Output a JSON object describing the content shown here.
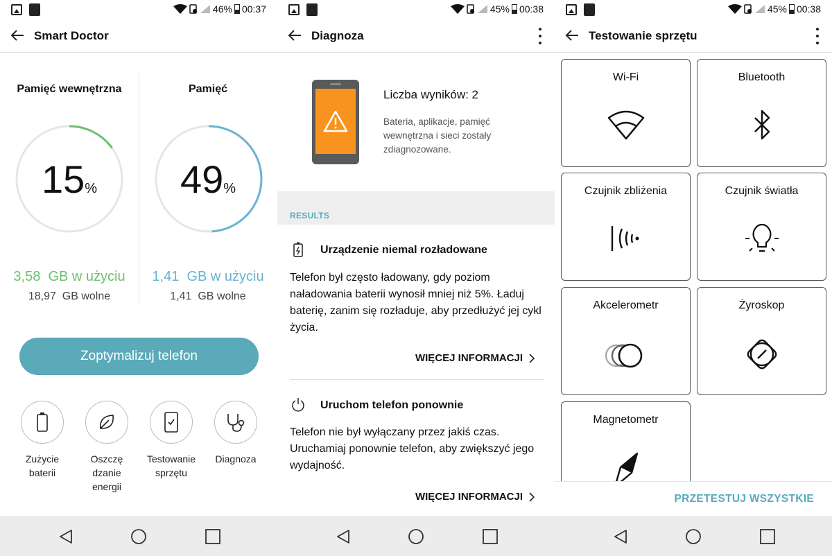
{
  "colors": {
    "accent": "#5aaab9",
    "green": "#6dbf6f",
    "blue": "#6ab4cf",
    "track": "#e6e6e6"
  },
  "panels": [
    {
      "status": {
        "battery": "46%",
        "time": "00:37"
      },
      "title": "Smart Doctor",
      "gauges": [
        {
          "label": "Pamięć wewnętrzna",
          "percent": 15,
          "value": "15",
          "unit": "%",
          "used_num": "3,58",
          "used_text": "GB w użyciu",
          "free_num": "18,97",
          "free_text": "GB wolne",
          "color": "#6dbf6f"
        },
        {
          "label": "Pamięć",
          "percent": 49,
          "value": "49",
          "unit": "%",
          "used_num": "1,41",
          "used_text": "GB w użyciu",
          "free_num": "1,41",
          "free_text": "GB wolne",
          "color": "#6ab4cf"
        }
      ],
      "optimize_label": "Zoptymalizuj telefon",
      "tools": [
        {
          "label_line1": "Zużycie",
          "label_line2": "baterii",
          "label_line3": "",
          "icon": "battery-icon"
        },
        {
          "label_line1": "Oszczę",
          "label_line2": "dzanie",
          "label_line3": "energii",
          "icon": "leaf-icon"
        },
        {
          "label_line1": "Testowanie",
          "label_line2": "sprzętu",
          "label_line3": "",
          "icon": "phone-check-icon"
        },
        {
          "label_line1": "Diagnoza",
          "label_line2": "",
          "label_line3": "",
          "icon": "stethoscope-icon"
        }
      ]
    },
    {
      "status": {
        "battery": "45%",
        "time": "00:38"
      },
      "title": "Diagnoza",
      "results_count": "Liczba wyników: 2",
      "results_desc": "Bateria, aplikacje, pamięć wewnętrzna i sieci zostały zdiagnozowane.",
      "results_header": "RESULTS",
      "issues": [
        {
          "title": "Urządzenie niemal rozładowane",
          "text": "Telefon był często ładowany, gdy poziom naładowania baterii wynosił mniej niż 5%. Ładuj baterię, zanim się rozładuje, aby przedłużyć jej cykl życia.",
          "more": "WIĘCEJ INFORMACJI",
          "icon": "battery-low-icon"
        },
        {
          "title": "Uruchom telefon ponownie",
          "text": "Telefon nie był wyłączany przez jakiś czas. Uruchamiaj ponownie telefon, aby zwiększyć jego wydajność.",
          "more": "WIĘCEJ INFORMACJI",
          "icon": "power-icon"
        }
      ]
    },
    {
      "status": {
        "battery": "45%",
        "time": "00:38"
      },
      "title": "Testowanie sprzętu",
      "tiles": [
        {
          "label": "Wi-Fi",
          "icon": "wifi-icon"
        },
        {
          "label": "Bluetooth",
          "icon": "bluetooth-icon"
        },
        {
          "label": "Czujnik zbliżenia",
          "icon": "proximity-icon"
        },
        {
          "label": "Czujnik światła",
          "icon": "light-bulb-icon"
        },
        {
          "label": "Akcelerometr",
          "icon": "accelerometer-icon"
        },
        {
          "label": "Żyroskop",
          "icon": "gyroscope-icon"
        },
        {
          "label": "Magnetometr",
          "icon": "compass-icon"
        }
      ],
      "test_all": "PRZETESTUJ WSZYSTKIE"
    }
  ]
}
